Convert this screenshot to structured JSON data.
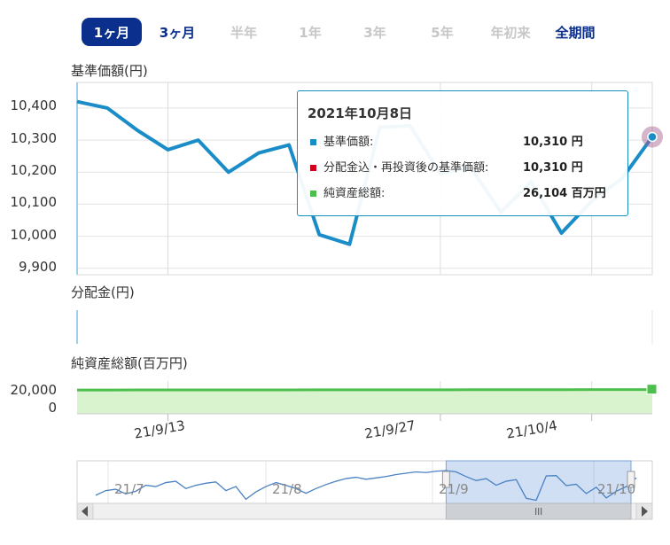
{
  "periods": [
    {
      "label": "1ヶ月",
      "state": "active"
    },
    {
      "label": "3ヶ月",
      "state": "enabled"
    },
    {
      "label": "半年",
      "state": "disabled"
    },
    {
      "label": "1年",
      "state": "disabled"
    },
    {
      "label": "3年",
      "state": "disabled"
    },
    {
      "label": "5年",
      "state": "disabled"
    },
    {
      "label": "年初来",
      "state": "disabled"
    },
    {
      "label": "全期間",
      "state": "enabled"
    }
  ],
  "panels": {
    "nav_label": "基準価額(円)",
    "dividend_label": "分配金(円)",
    "assets_label": "純資産総額(百万円)"
  },
  "tooltip": {
    "date": "2021年10月8日",
    "rows": [
      {
        "name": "基準価額:",
        "value": "10,310 円",
        "color": "#1a8dc8"
      },
      {
        "name": "分配金込・再投資後の基準価額:",
        "value": "10,310 円",
        "color": "#d0021b"
      },
      {
        "name": "純資産総額:",
        "value": "26,104 百万円",
        "color": "#4cbf4c"
      }
    ]
  },
  "chart_data": {
    "type": "line",
    "nav": {
      "ylabel": "基準価額(円)",
      "yticks": [
        "10,400",
        "10,300",
        "10,200",
        "10,100",
        "10,000",
        "9,900"
      ],
      "ylim": [
        9880,
        10480
      ],
      "series": [
        {
          "name": "基準価額",
          "color": "#1a8dc8",
          "values": [
            10420,
            10400,
            10330,
            10270,
            10300,
            10200,
            10260,
            10285,
            10005,
            9975,
            10340,
            10345,
            10195,
            10215,
            10075,
            10170,
            10010,
            10110,
            10180,
            10310
          ]
        }
      ]
    },
    "assets": {
      "ylabel": "純資産総額(百万円)",
      "yticks": [
        "20,000",
        "0"
      ],
      "ylim": [
        0,
        30000
      ],
      "series": [
        {
          "name": "純資産総額",
          "color": "#4cbf4c",
          "values": [
            25600,
            25650,
            25700,
            25720,
            25750,
            25760,
            25780,
            25800,
            25820,
            25840,
            25880,
            25900,
            25920,
            25950,
            25980,
            26000,
            26030,
            26060,
            26080,
            26104
          ]
        }
      ]
    },
    "x_ticks": [
      "21/9/13",
      "21/9/27",
      "21/10/4"
    ],
    "navigator": {
      "labels": [
        "21/7",
        "21/8",
        "21/9",
        "21/10"
      ],
      "values": [
        10050,
        10120,
        10140,
        10070,
        10110,
        10200,
        10180,
        10240,
        10260,
        10150,
        10200,
        10230,
        10250,
        10120,
        10180,
        9990,
        10100,
        10180,
        10240,
        10200,
        10150,
        10080,
        10150,
        10210,
        10260,
        10300,
        10320,
        10290,
        10310,
        10330,
        10360,
        10380,
        10400,
        10390,
        10410,
        10420,
        10400,
        10330,
        10270,
        10300,
        10200,
        10260,
        10285,
        10005,
        9975,
        10340,
        10345,
        10195,
        10215,
        10075,
        10170,
        10010,
        10110,
        10180,
        10310
      ],
      "selected_start_index": 35
    }
  }
}
